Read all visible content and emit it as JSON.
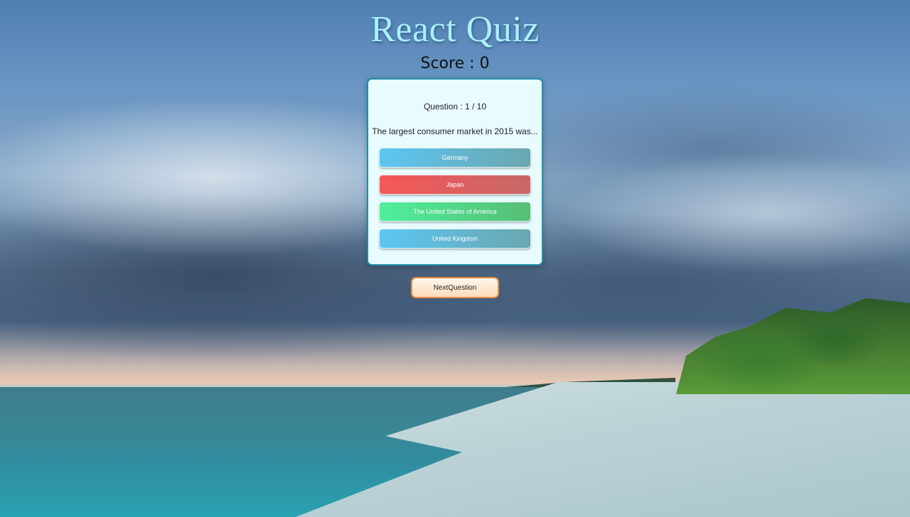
{
  "app": {
    "title": "React Quiz",
    "score_text": "Score : 0"
  },
  "quiz": {
    "question_number": "Question : 1 / 10",
    "question": "The largest consumer market in 2015 was...",
    "answers": [
      {
        "label": "Germany",
        "color": "#5cc6f3"
      },
      {
        "label": "Japan",
        "color": "#f65757"
      },
      {
        "label": "The United States of America",
        "color": "#4fef9c"
      },
      {
        "label": "United Kingdom",
        "color": "#5cc6f3"
      }
    ],
    "next_label": "NextQuestion"
  }
}
